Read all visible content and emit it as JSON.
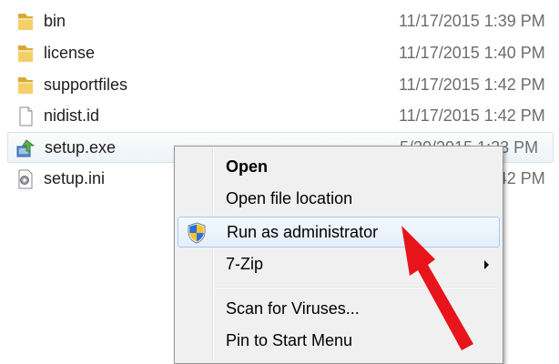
{
  "files": [
    {
      "name": "bin",
      "date": "11/17/2015 1:39 PM",
      "icon": "folder-icon"
    },
    {
      "name": "license",
      "date": "11/17/2015 1:40 PM",
      "icon": "folder-icon"
    },
    {
      "name": "supportfiles",
      "date": "11/17/2015 1:42 PM",
      "icon": "folder-icon"
    },
    {
      "name": "nidist.id",
      "date": "11/17/2015 1:42 PM",
      "icon": "document-icon"
    },
    {
      "name": "setup.exe",
      "date": "5/20/2015 1:33 PM",
      "icon": "installer-icon"
    },
    {
      "name": "setup.ini",
      "date": "11/17/2015 1:42 PM",
      "icon": "settings-file-icon"
    }
  ],
  "context_menu": {
    "items": [
      {
        "label": "Open",
        "bold": true
      },
      {
        "label": "Open file location"
      },
      {
        "label": "Run as administrator",
        "icon": "uac-shield-icon",
        "highlighted": true
      },
      {
        "label": "7-Zip",
        "has_submenu": true
      },
      {
        "label": "Scan for Viruses..."
      },
      {
        "label": "Pin to Start Menu"
      }
    ]
  },
  "colors": {
    "annotation_arrow": "#e8141b",
    "folder": "#e8b84a",
    "menu_highlight_border": "#a8cbec"
  }
}
